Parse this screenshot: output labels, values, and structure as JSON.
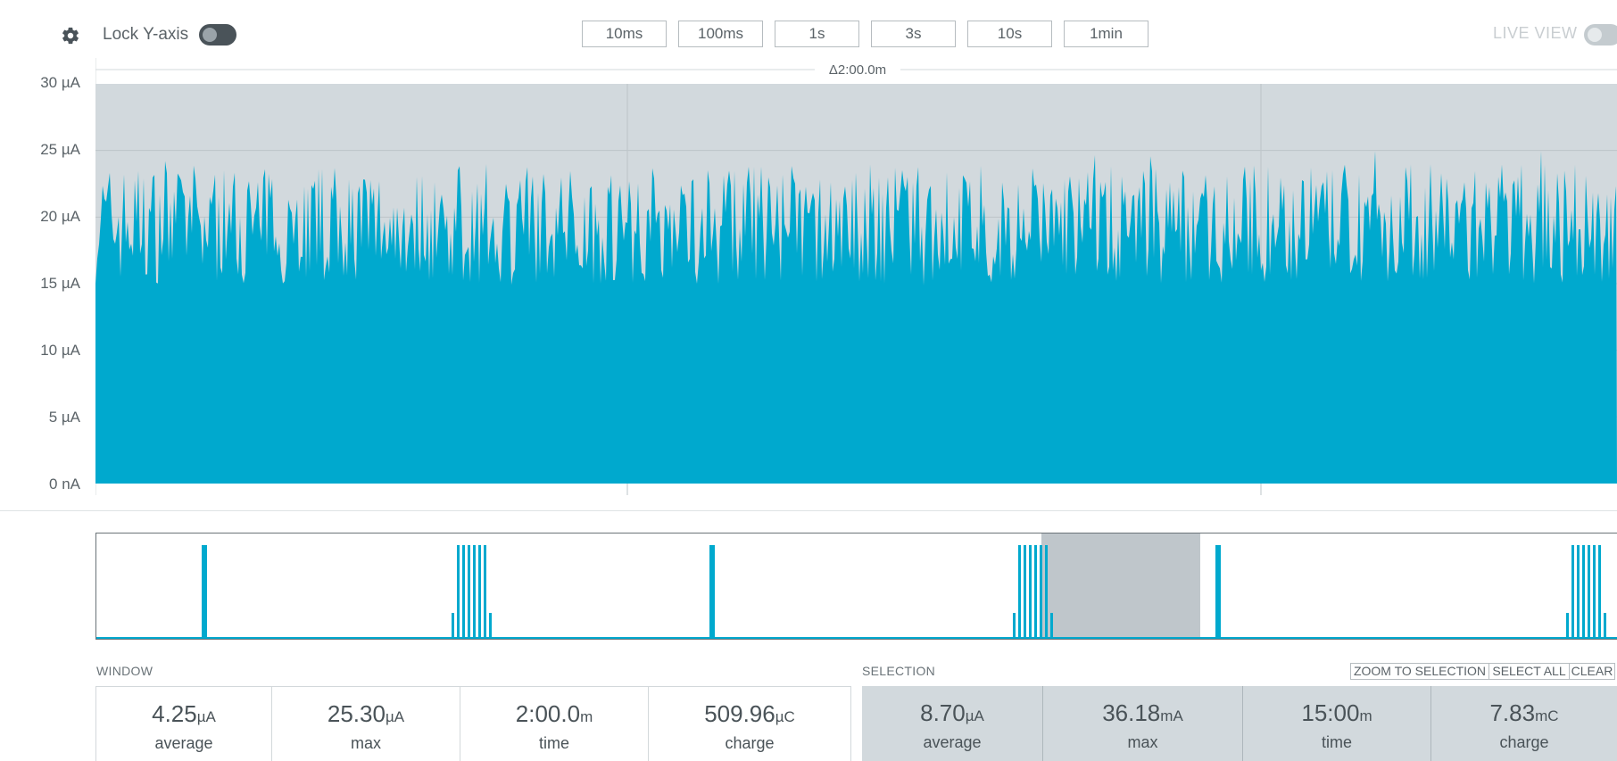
{
  "toolbar": {
    "settings_icon": "gear-icon",
    "lock_label": "Lock Y-axis",
    "lock_state": false,
    "zoom_buttons": [
      "10ms",
      "100ms",
      "1s",
      "3s",
      "10s",
      "1min"
    ],
    "live_view_label": "LIVE VIEW",
    "live_view_state": false
  },
  "chart_data": {
    "type": "area",
    "ylabel_ticks": [
      "30 µA",
      "25 µA",
      "20 µA",
      "15 µA",
      "10 µA",
      "5 µA",
      "0 nA"
    ],
    "ylim": [
      0,
      30
    ],
    "window_label": "Δ2:00.0m",
    "series_color": "#00a9ce",
    "baseline_min": 15,
    "baseline_max": 24,
    "peak": 25.3
  },
  "minimap": {
    "series_color": "#00a9ce",
    "selection_color": "#b8c0c5"
  },
  "window": {
    "label": "WINDOW",
    "stats": [
      {
        "value": "4.25",
        "unit": "µA",
        "label": "average"
      },
      {
        "value": "25.30",
        "unit": "µA",
        "label": "max"
      },
      {
        "value": "2:00.0",
        "unit": "m",
        "label": "time"
      },
      {
        "value": "509.96",
        "unit": "µC",
        "label": "charge"
      }
    ]
  },
  "selection": {
    "label": "SELECTION",
    "buttons": [
      "ZOOM TO SELECTION",
      "SELECT ALL",
      "CLEAR"
    ],
    "stats": [
      {
        "value": "8.70",
        "unit": "µA",
        "label": "average"
      },
      {
        "value": "36.18",
        "unit": "mA",
        "label": "max"
      },
      {
        "value": "15:00",
        "unit": "m",
        "label": "time"
      },
      {
        "value": "7.83",
        "unit": "mC",
        "label": "charge"
      }
    ]
  }
}
